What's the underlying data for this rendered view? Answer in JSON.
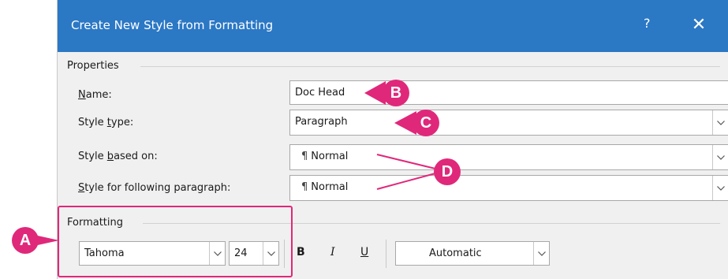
{
  "dialog": {
    "title": "Create New Style from Formatting",
    "help": "?",
    "close": "✕"
  },
  "properties": {
    "group_label": "Properties",
    "name_label_u": "N",
    "name_label_rest": "ame:",
    "name_value": "Doc Head",
    "type_label_pre": "Style ",
    "type_label_u": "t",
    "type_label_rest": "ype:",
    "type_value": "Paragraph",
    "based_label_pre": "Style ",
    "based_label_u": "b",
    "based_label_rest": "ased on:",
    "based_value": "Normal",
    "following_label_u": "S",
    "following_label_rest": "tyle for following paragraph:",
    "following_value": "Normal",
    "pilcrow": "¶"
  },
  "formatting": {
    "group_label": "Formatting",
    "font": "Tahoma",
    "size": "24",
    "bold": "B",
    "italic": "I",
    "underline": "U",
    "color": "Automatic"
  },
  "callouts": {
    "a": "A",
    "b": "B",
    "c": "C",
    "d": "D"
  },
  "colors": {
    "titlebar": "#2b78c5",
    "callout": "#e0287a"
  }
}
